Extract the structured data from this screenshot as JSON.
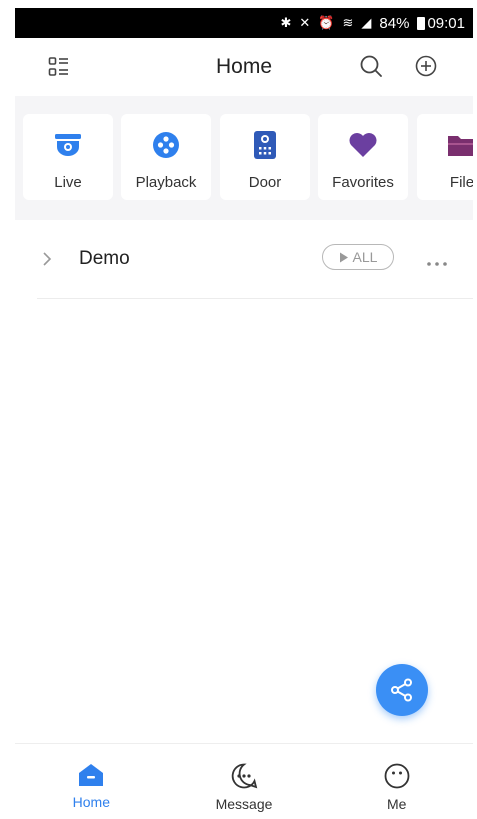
{
  "status_bar": {
    "battery": "84%",
    "time": "09:01"
  },
  "header": {
    "title": "Home"
  },
  "shortcuts": [
    {
      "label": "Live",
      "icon": "dome-camera-icon"
    },
    {
      "label": "Playback",
      "icon": "playback-reel-icon"
    },
    {
      "label": "Door",
      "icon": "door-intercom-icon"
    },
    {
      "label": "Favorites",
      "icon": "heart-icon"
    },
    {
      "label": "File",
      "icon": "folder-icon"
    }
  ],
  "device_group": {
    "name": "Demo",
    "play_all_label": "ALL"
  },
  "tabs": [
    {
      "label": "Home",
      "active": true
    },
    {
      "label": "Message",
      "active": false
    },
    {
      "label": "Me",
      "active": false
    }
  ],
  "colors": {
    "accent": "#2f80ed",
    "fab": "#3a8ff5",
    "heart": "#6b3fa0",
    "folder": "#7a2f6e"
  }
}
